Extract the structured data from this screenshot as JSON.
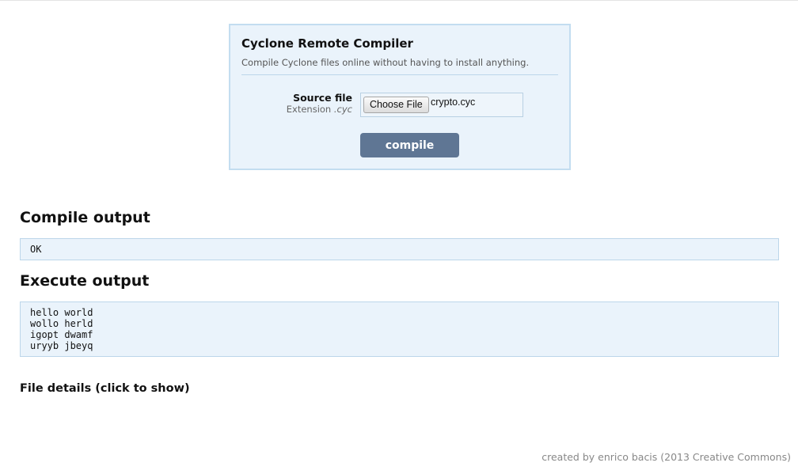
{
  "upload_panel": {
    "title": "Cyclone Remote Compiler",
    "subtitle": "Compile Cyclone files online without having to install anything.",
    "source_file": {
      "label": "Source file",
      "hint_prefix": "Extension ",
      "hint_extension": ".cyc",
      "choose_button_label": "Choose File",
      "selected_file": "crypto.cyc"
    },
    "compile_label": "compile"
  },
  "compile_output": {
    "heading": "Compile output",
    "text": "OK"
  },
  "execute_output": {
    "heading": "Execute output",
    "text": "hello world\nwollo herld\nigopt dwamf\nuryyb jbeyq"
  },
  "file_details": {
    "label": "File details (click to show)"
  },
  "footer": {
    "credit": "created by enrico bacis (2013 Creative Commons)"
  },
  "colors": {
    "panel_background": "#eaf3fb",
    "panel_border": "#c3ddf0",
    "compile_button": "#5f7694",
    "footer_text": "#888888"
  }
}
